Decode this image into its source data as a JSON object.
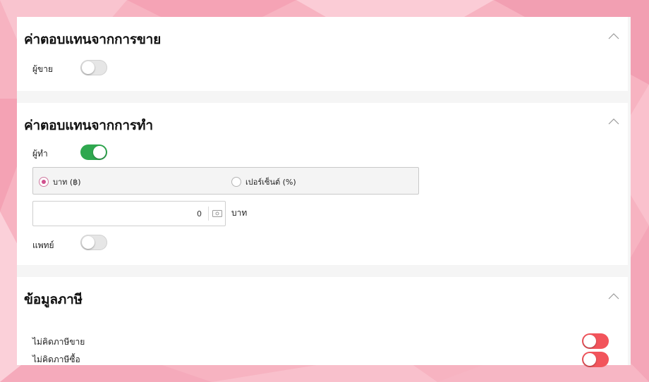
{
  "sales_commission": {
    "title": "ค่าตอบแทนจากการขาย",
    "seller_label": "ผู้ขาย",
    "seller_enabled": false,
    "collapse_icon": "chevron-up-icon"
  },
  "work_commission": {
    "title": "ค่าตอบแทนจากการทำ",
    "doer_label": "ผู้ทำ",
    "doer_enabled": true,
    "radio_baht_label": "บาท (฿)",
    "radio_percent_label": "เปอร์เซ็นต์ (%)",
    "selected_option": "baht",
    "amount_value": "0",
    "amount_icon": "money-icon",
    "unit_label": "บาท",
    "doctor_label": "แพทย์",
    "doctor_enabled": false,
    "collapse_icon": "chevron-up-icon"
  },
  "tax_info": {
    "title": "ข้อมูลภาษี",
    "no_sales_tax_label": "ไม่คิดภาษีขาย",
    "no_sales_tax_enabled": false,
    "no_purchase_tax_label": "ไม่คิดภาษีซื้อ",
    "no_purchase_tax_enabled": false,
    "collapse_icon": "chevron-up-icon"
  },
  "colors": {
    "toggle_on": "#2fa84f",
    "toggle_off": "#e6e6e6",
    "toggle_alert": "#f2545b",
    "radio_accent": "#d0508e"
  }
}
